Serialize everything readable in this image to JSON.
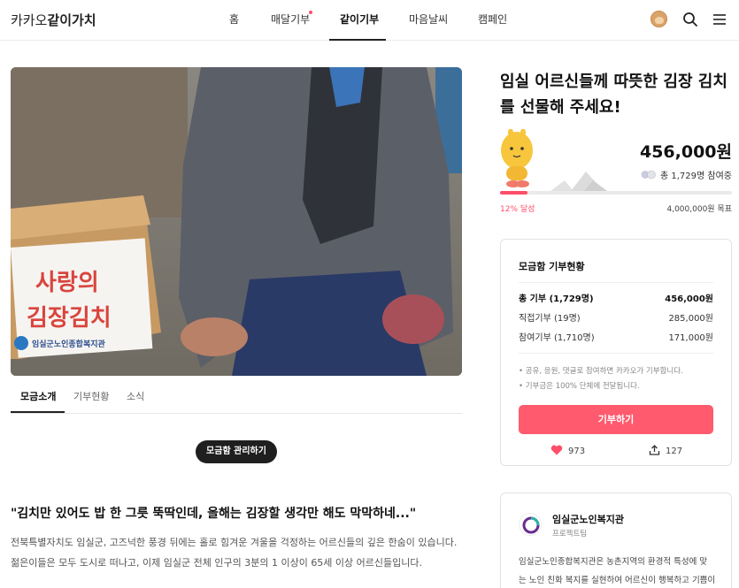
{
  "header": {
    "logo_prefix": "카카오",
    "logo_main": "같이가치",
    "nav": [
      {
        "label": "홈"
      },
      {
        "label": "매달기부"
      },
      {
        "label": "같이기부"
      },
      {
        "label": "마음날씨"
      },
      {
        "label": "캠페인"
      }
    ],
    "active_nav": "같이기부"
  },
  "hero": {
    "box_text_line1": "사랑의",
    "box_text_line2": "김장김치",
    "box_org": "임실군노인종합복지관"
  },
  "tabs": [
    {
      "label": "모금소개"
    },
    {
      "label": "기부현황"
    },
    {
      "label": "소식"
    }
  ],
  "manage_button": "모금함 관리하기",
  "story": {
    "quote": "\"김치만 있어도 밥 한 그릇 뚝딱인데, 올해는 김장할 생각만 해도 막막하네...\"",
    "line1": "전북특별자치도 임실군, 고즈넉한 풍경 뒤에는 홀로 힘겨운 겨울을 걱정하는 어르신들의 깊은 한숨이 있습니다.",
    "line2": "젊은이들은 모두 도시로 떠나고, 이제 임실군 전체 인구의 3분의 1 이상이 65세 이상 어르신들입니다."
  },
  "campaign": {
    "title": "임실 어르신들께 따뜻한 김장 김치를 선물해 주세요!",
    "amount": "456,000원",
    "participants": "총 1,729명 참여중",
    "progress_percent": 12,
    "achieve_label": "12% 달성",
    "goal_label": "4,000,000원 목표"
  },
  "status_card": {
    "title": "모금함 기부현황",
    "rows": [
      {
        "label": "총 기부 (1,729명)",
        "value": "456,000원"
      },
      {
        "label": "직접기부 (19명)",
        "value": "285,000원"
      },
      {
        "label": "참여기부 (1,710명)",
        "value": "171,000원"
      }
    ],
    "notes": [
      "• 공유, 응원, 댓글로 참여하면 카카오가 기부합니다.",
      "• 기부금은 100% 단체에 전달됩니다."
    ],
    "donate_button": "기부하기",
    "likes": "973",
    "shares": "127"
  },
  "org": {
    "name": "임실군노인복지관",
    "role": "프로젝트팀",
    "desc1": "임실군노인종합복지관은 농촌지역의 환경적 특성에 맞",
    "desc2": "는 노인 친화 복지를 실현하여 어르신이 행복하고 기쁨이"
  },
  "colors": {
    "accent": "#ff4d6a",
    "button": "#ff5a6e",
    "dark": "#1f1f1f"
  }
}
